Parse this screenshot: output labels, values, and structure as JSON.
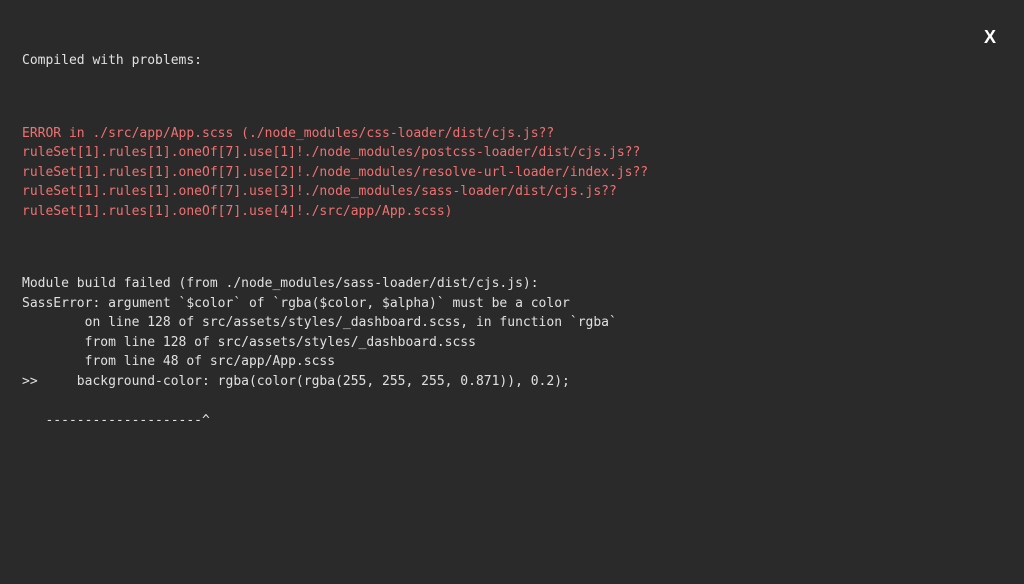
{
  "overlay": {
    "close_label": "X",
    "title": "Compiled with problems:",
    "error_header": "ERROR in ./src/app/App.scss (./node_modules/css-loader/dist/cjs.js??\nruleSet[1].rules[1].oneOf[7].use[1]!./node_modules/postcss-loader/dist/cjs.js??\nruleSet[1].rules[1].oneOf[7].use[2]!./node_modules/resolve-url-loader/index.js??\nruleSet[1].rules[1].oneOf[7].use[3]!./node_modules/sass-loader/dist/cjs.js??\nruleSet[1].rules[1].oneOf[7].use[4]!./src/app/App.scss)",
    "module_error": "Module build failed (from ./node_modules/sass-loader/dist/cjs.js):\nSassError: argument `$color` of `rgba($color, $alpha)` must be a color\n        on line 128 of src/assets/styles/_dashboard.scss, in function `rgba`\n        from line 128 of src/assets/styles/_dashboard.scss\n        from line 48 of src/app/App.scss\n>>     background-color: rgba(color(rgba(255, 255, 255, 0.871)), 0.2);\n\n   --------------------^"
  }
}
